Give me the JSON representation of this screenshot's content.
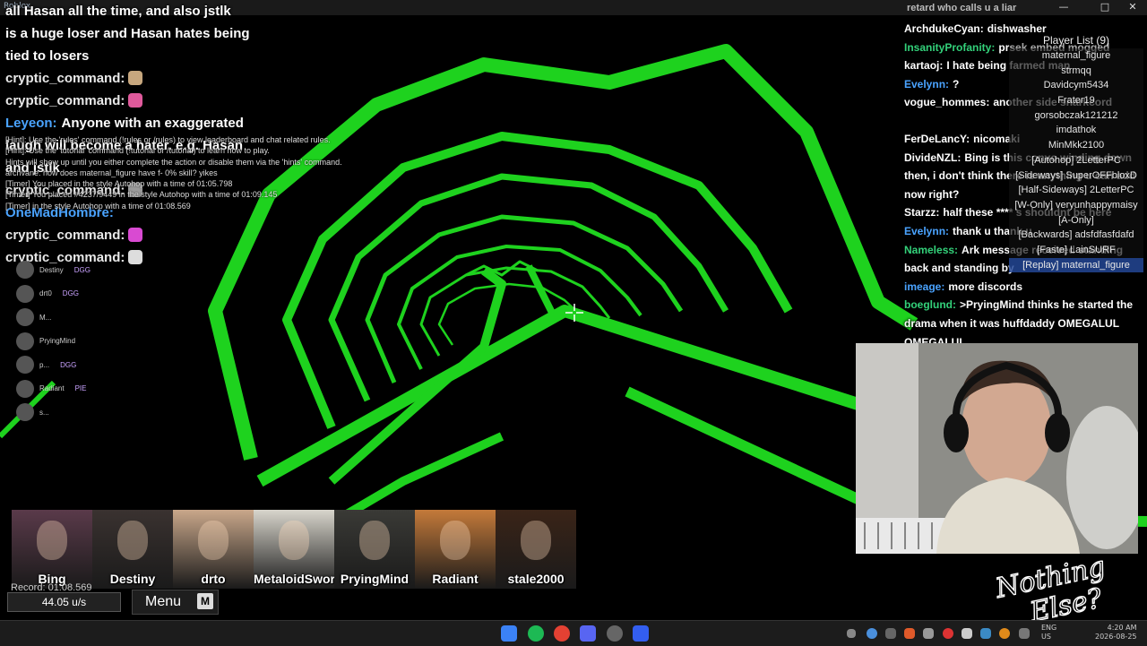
{
  "window": {
    "title": "Roblox",
    "overlay_chat_top": "retard who calls u a liar"
  },
  "left_chat": [
    {
      "user": "",
      "text": "all Hasan all the time, and also jstlk",
      "cls": "u1"
    },
    {
      "user": "",
      "text": "is a huge loser and Hasan hates being",
      "cls": "u1"
    },
    {
      "user": "",
      "text": "tied to losers",
      "cls": "u1"
    },
    {
      "user": "cryptic_command:",
      "text": "",
      "cls": "user",
      "emote": "#c7a77e"
    },
    {
      "user": "cryptic_command:",
      "text": "",
      "cls": "user",
      "emote": "#e05a9c"
    },
    {
      "user": "Leyeon:",
      "text": "Anyone with an exaggerated",
      "cls": "blue"
    },
    {
      "user": "",
      "text": "laugh will become a hater. e.g. Hasan",
      "cls": "u1"
    },
    {
      "user": "",
      "text": "and jstlk",
      "cls": "u1"
    },
    {
      "user": "cryptic_command:",
      "text": "",
      "cls": "user",
      "emote": "#9b9b9b"
    },
    {
      "user": "OneMadHombre:",
      "text": "",
      "cls": "blue"
    },
    {
      "user": "cryptic_command:",
      "text": "",
      "cls": "user",
      "emote": "#d94ad2"
    },
    {
      "user": "cryptic_command:",
      "text": "",
      "cls": "user",
      "emote": "#dddddd"
    }
  ],
  "hint_log": [
    "[Hint]: Use the 'rules' command (!rules or /rules) to view leaderboard and chat related rules.",
    "[Hint]: Use the 'tutorial' command (!tutorial or /tutorial) to learn how to play.",
    "Hints will show up until you either complete the action or disable them via the 'hints' command.",
    "archvane: how does maternal_figure have f- 0% skill? yikes",
    "[Timer] You placed in the style Autohop with a time of 01:05.798",
    "[Timer] You placed #4237/9449 in the style Autohop with a time of 01:09.145",
    "[Timer] in the style Autohop with a time of 01:08.569"
  ],
  "voice_list": [
    {
      "name": "Destiny",
      "tag": "DGG"
    },
    {
      "name": "drt0",
      "tag": "DGG"
    },
    {
      "name": "M...",
      "tag": ""
    },
    {
      "name": "PryingMind",
      "tag": ""
    },
    {
      "name": "p...",
      "tag": "DGG"
    },
    {
      "name": "Radiant",
      "tag": "PIE"
    },
    {
      "name": "s...",
      "tag": ""
    }
  ],
  "right_chat": [
    {
      "user": "ArchdukeCyan:",
      "color": "#ffffff",
      "text": "dishwasher"
    },
    {
      "user": "InsanityProfanity:",
      "color": "#33d17a",
      "text": "prsek embed mogged"
    },
    {
      "user": "kartaoj:",
      "color": "#ffffff",
      "text": "I hate being farmed man"
    },
    {
      "user": "Evelynn:",
      "color": "#4aa3ff",
      "text": "?"
    },
    {
      "user": "vogue_hommes:",
      "color": "#ffffff",
      "text": "another side snarkcord"
    },
    {
      "user": "",
      "color": "#ff5555",
      "text": ""
    },
    {
      "user": "FerDeLancY:",
      "color": "#ffffff",
      "text": "nicomaki"
    },
    {
      "user": "DivideNZL:",
      "color": "#ffffff",
      "text": "Bing is this convo winding down then, i don't think there is anything u can add now right?"
    },
    {
      "user": "Starzz:",
      "color": "#ffffff",
      "text": "half these **** s shouldnt be here"
    },
    {
      "user": "Evelynn:",
      "color": "#4aa3ff",
      "text": "thank u thank u"
    },
    {
      "user": "Nameless:",
      "color": "#33d17a",
      "text": "Ark message received standing back and standing by"
    },
    {
      "user": "imeage:",
      "color": "#4aa3ff",
      "text": "more discords"
    },
    {
      "user": "boeglund:",
      "color": "#33d17a",
      "text": ">PryingMind thinks he started the drama when it was huffdaddy OMEGALUL OMEGALUL"
    }
  ],
  "player_list": {
    "title": "Player List (9)",
    "items": [
      "maternal_figure",
      "strmqq",
      "Davidcym5434",
      "Frater19",
      "gorsobczak121212",
      "imdathok",
      "MinMkk2100",
      "[Autohop] 2LetterPC",
      "[Sideways] SuperOFFbloxD",
      "[Half-Sideways] 2LetterPC",
      "[W-Only] veryunhappymaisy",
      "[A-Only]",
      "[Backwards] adsfdfasfdafd",
      "[Faste] LainSURF",
      "[Replay] maternal_figure"
    ],
    "selected": 14
  },
  "cards": [
    {
      "name": "Bing",
      "bg": "#5a3a4a"
    },
    {
      "name": "Destiny",
      "bg": "#3a3230"
    },
    {
      "name": "drto",
      "bg": "#c9a78a"
    },
    {
      "name": "MetaloidSword",
      "bg": "#d8d5cc"
    },
    {
      "name": "PryingMind",
      "bg": "#3a3a36"
    },
    {
      "name": "Radiant",
      "bg": "#c47a3a"
    },
    {
      "name": "stale2000",
      "bg": "#3a2418"
    }
  ],
  "hud": {
    "record": "Record: 01:08.569",
    "speed": "44.05 u/s",
    "menu": "Menu",
    "menu_key": "M"
  },
  "taskbar": {
    "lang": "ENG\nUS",
    "time": "4:20 AM",
    "date": "2026-08-25"
  },
  "overlay": {
    "watermark": "Nothing Else?"
  }
}
